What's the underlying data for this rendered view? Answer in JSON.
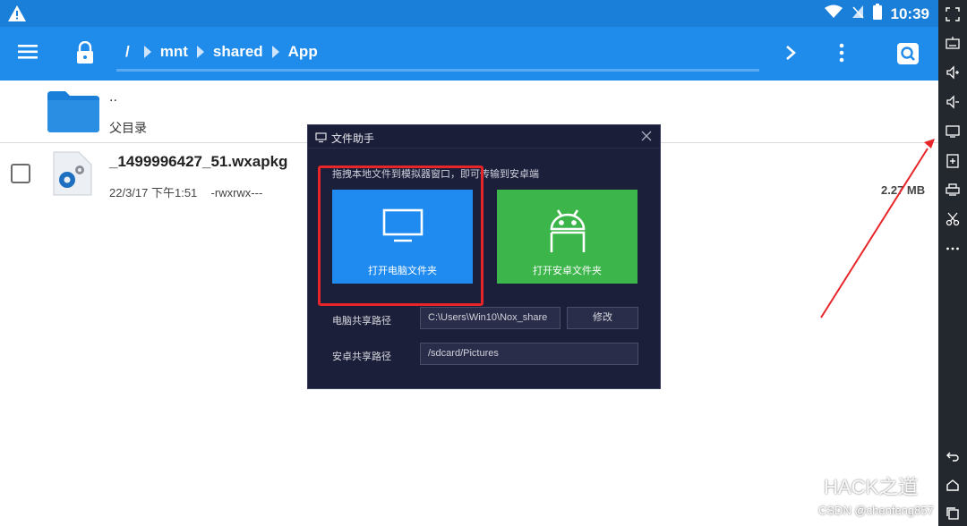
{
  "status_bar": {
    "time": "10:39"
  },
  "app_bar": {
    "breadcrumbs": [
      "/",
      "mnt",
      "shared",
      "App"
    ]
  },
  "file_list": {
    "parent": {
      "dots": "..",
      "label": "父目录"
    },
    "files": [
      {
        "name": "_1499996427_51.wxapkg",
        "date": "22/3/17 下午1:51",
        "permissions": "-rwxrwx---",
        "size": "2.27 MB"
      }
    ]
  },
  "dialog": {
    "title": "文件助手",
    "hint": "拖拽本地文件到模拟器窗口，即可传输到安卓端",
    "pc_tile_label": "打开电脑文件夹",
    "android_tile_label": "打开安卓文件夹",
    "pc_path_label": "电脑共享路径",
    "pc_path_value": "C:\\Users\\Win10\\Nox_share",
    "modify_label": "修改",
    "android_path_label": "安卓共享路径",
    "android_path_value": "/sdcard/Pictures"
  },
  "watermark": {
    "main": "HACK之道",
    "csdn": "CSDN @chenfeng857"
  },
  "colors": {
    "status_bar": "#1a7fd9",
    "app_bar": "#1f8bea",
    "pc_tile": "#1f8bf0",
    "android_tile": "#3cb54b",
    "dialog_bg": "#1c1f3a",
    "annotation": "#e8262a"
  }
}
